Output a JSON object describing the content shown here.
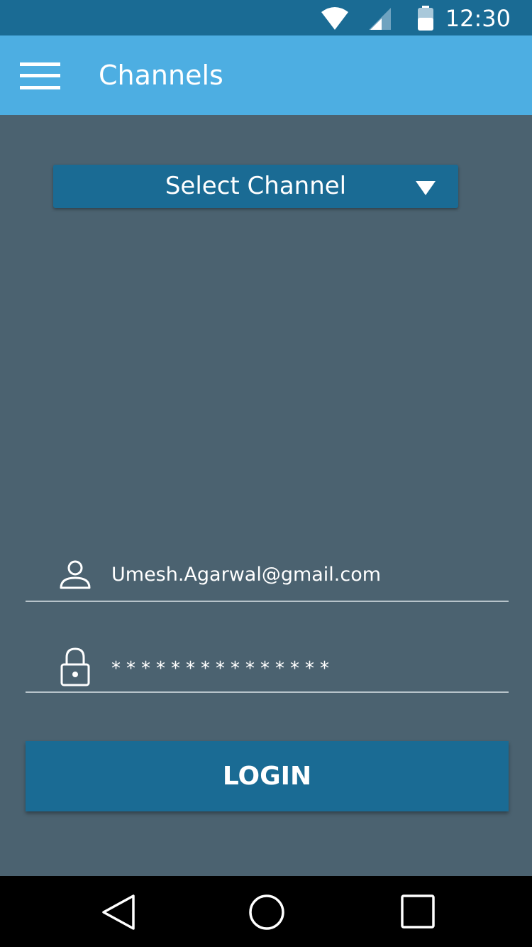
{
  "status_bar": {
    "time": "12:30",
    "icons": [
      "wifi-icon",
      "signal-icon",
      "battery-icon"
    ]
  },
  "app_bar": {
    "title": "Channels",
    "menu_icon": "hamburger-menu-icon"
  },
  "channel_select": {
    "label": "Select Channel",
    "icon": "dropdown-caret-icon"
  },
  "login_form": {
    "email": {
      "icon": "user-icon",
      "value": "Umesh.Agarwal@gmail.com"
    },
    "password": {
      "icon": "lock-icon",
      "value": "***************"
    },
    "login_label": "LOGIN"
  },
  "nav_bar": {
    "icons": [
      "back-icon",
      "home-icon",
      "recents-icon"
    ]
  },
  "colors": {
    "status_bar": "#1a6b94",
    "app_bar": "#4daee2",
    "background": "#4b6270",
    "button": "#1a6b94",
    "nav_bar": "#000000"
  }
}
